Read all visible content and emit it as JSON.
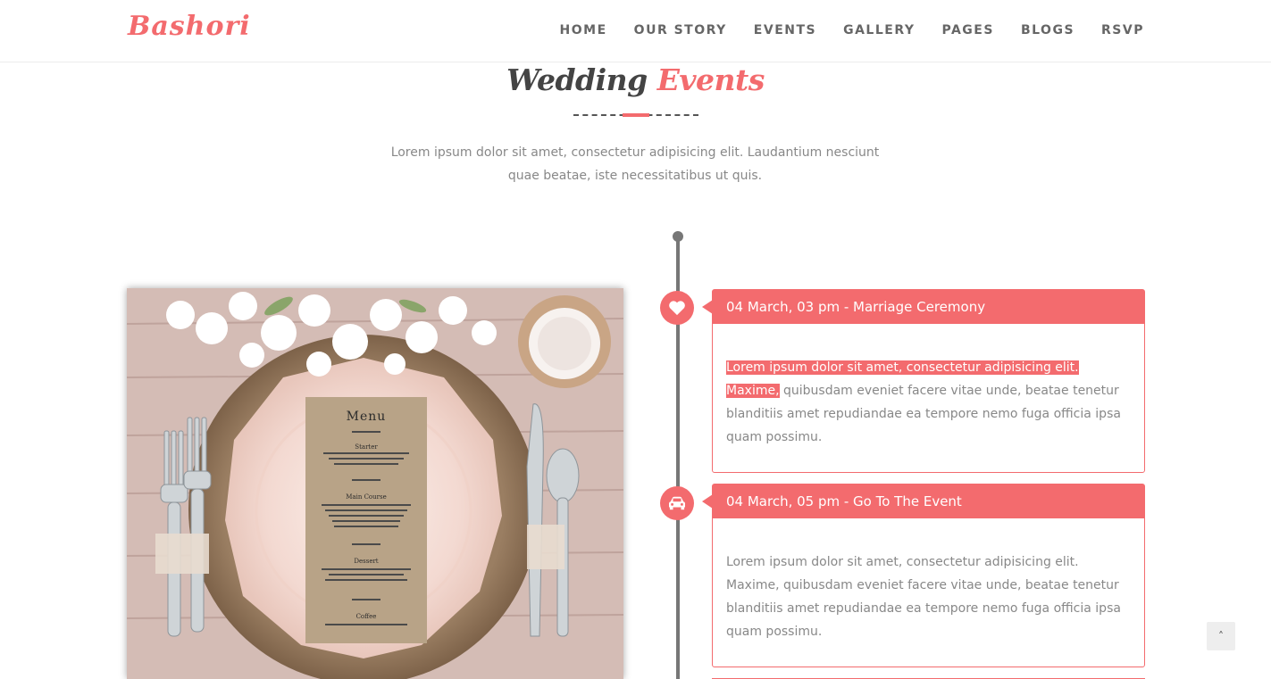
{
  "header": {
    "logo": "Bashori",
    "nav": [
      "HOME",
      "OUR STORY",
      "EVENTS",
      "GALLERY",
      "PAGES",
      "BLOGS",
      "RSVP"
    ]
  },
  "section": {
    "title_main": "Wedding",
    "title_accent": "Events",
    "intro": "Lorem ipsum dolor sit amet, consectetur adipisicing elit. Laudantium nesciunt quae beatae, iste necessitatibus ut quis."
  },
  "image": {
    "menu": {
      "heading": "Menu",
      "courses": [
        {
          "name": "Starter",
          "desc": "Roasted Tomato Soup with Basil Oil or Tartar of Crab with Roquette Pesto"
        },
        {
          "name": "Main Course",
          "desc": "Roast Sirloin of Scotch Beef presented with a Shallot and Red Wine Sauce or Roast Cherry Tomato and Spinach Blue Tartlet"
        },
        {
          "name": "Dessert",
          "desc": "Tiramisu with Tia Maria Sauce with a Biscotti Biscuit or Eton Mess - Using Seasonal Soft Fruits"
        },
        {
          "name": "Coffee",
          "desc": "A selection of freshly brewed coffees"
        }
      ]
    }
  },
  "events": [
    {
      "icon": "heart-icon",
      "title": "04 March, 03 pm - Marriage Ceremony",
      "highlight": "Lorem ipsum dolor sit amet, consectetur adipisicing elit. Maxime,",
      "text": " quibusdam eveniet facere vitae unde, beatae tenetur blanditiis amet repudiandae ea tempore nemo fuga officia ipsa quam possimu."
    },
    {
      "icon": "car-icon",
      "title": "04 March, 05 pm - Go To The Event",
      "highlight": "",
      "text": "Lorem ipsum dolor sit amet, consectetur adipisicing elit. Maxime, quibusdam eveniet facere vitae unde, beatae tenetur blanditiis amet repudiandae ea tempore nemo fuga officia ipsa quam possimu."
    }
  ],
  "scroll_top": {
    "icon": "chevron-up-icon",
    "glyph": "˄"
  },
  "colors": {
    "accent": "#f36b6e",
    "text": "#888888",
    "timeline": "#777777"
  }
}
